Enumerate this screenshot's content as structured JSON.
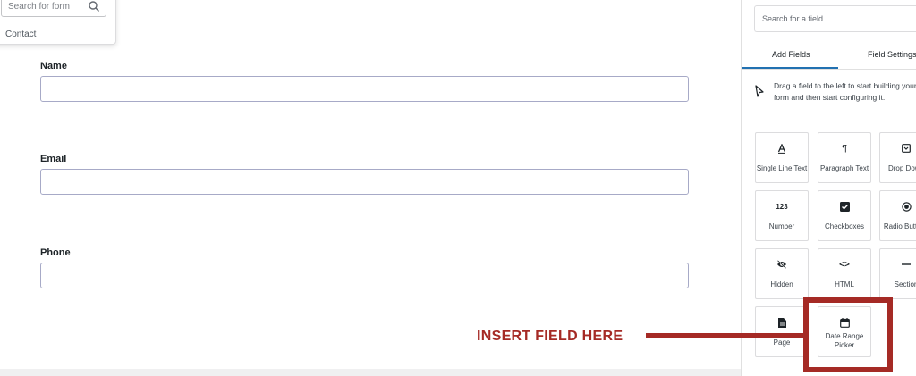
{
  "form_selector": {
    "search_placeholder": "Search for form",
    "items": [
      "Contact"
    ]
  },
  "form_fields": [
    {
      "label": "Name",
      "value": ""
    },
    {
      "label": "Email",
      "value": ""
    },
    {
      "label": "Phone",
      "value": ""
    }
  ],
  "sidebar": {
    "search_placeholder": "Search for a field",
    "tabs": [
      {
        "label": "Add Fields",
        "active": true
      },
      {
        "label": "Field Settings",
        "active": false
      }
    ],
    "hint": "Drag a field to the left to start building your form and then start configuring it.",
    "fields": [
      {
        "label": "Single Line Text",
        "icon": "text-icon"
      },
      {
        "label": "Paragraph Text",
        "icon": "paragraph-icon"
      },
      {
        "label": "Drop Down",
        "icon": "dropdown-icon"
      },
      {
        "label": "Number",
        "icon": "number-icon",
        "glyph": "123"
      },
      {
        "label": "Checkboxes",
        "icon": "checkbox-icon"
      },
      {
        "label": "Radio Buttons",
        "icon": "radio-icon"
      },
      {
        "label": "Hidden",
        "icon": "eye-slash-icon"
      },
      {
        "label": "HTML",
        "icon": "code-icon",
        "glyph": "<>"
      },
      {
        "label": "Section",
        "icon": "section-icon"
      },
      {
        "label": "Page",
        "icon": "page-icon"
      },
      {
        "label": "Date Range Picker",
        "icon": "calendar-icon"
      }
    ]
  },
  "annotation": {
    "text": "INSERT FIELD HERE",
    "color": "#a52a25"
  },
  "colors": {
    "accent": "#2271b1",
    "input_border": "#a7aac7"
  }
}
